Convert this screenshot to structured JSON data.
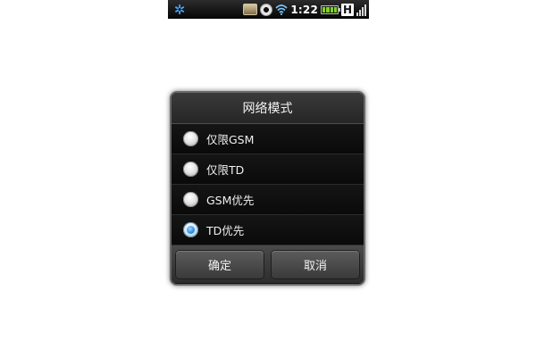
{
  "status_bar": {
    "time": "1:22",
    "network_type": "H",
    "icons": [
      "gear-icon",
      "photo-icon",
      "cd-icon",
      "wifi-icon",
      "battery-icon",
      "hsdpa-icon",
      "signal-icon"
    ]
  },
  "dialog": {
    "title": "网络模式",
    "options": [
      {
        "label": "仅限GSM",
        "checked": false
      },
      {
        "label": "仅限TD",
        "checked": false
      },
      {
        "label": "GSM优先",
        "checked": false
      },
      {
        "label": "TD优先",
        "checked": true
      }
    ],
    "confirm_label": "确定",
    "cancel_label": "取消"
  },
  "colors": {
    "accent": "#2f8de0",
    "dialog_bg": "#111111",
    "text": "#f0f0f0"
  }
}
